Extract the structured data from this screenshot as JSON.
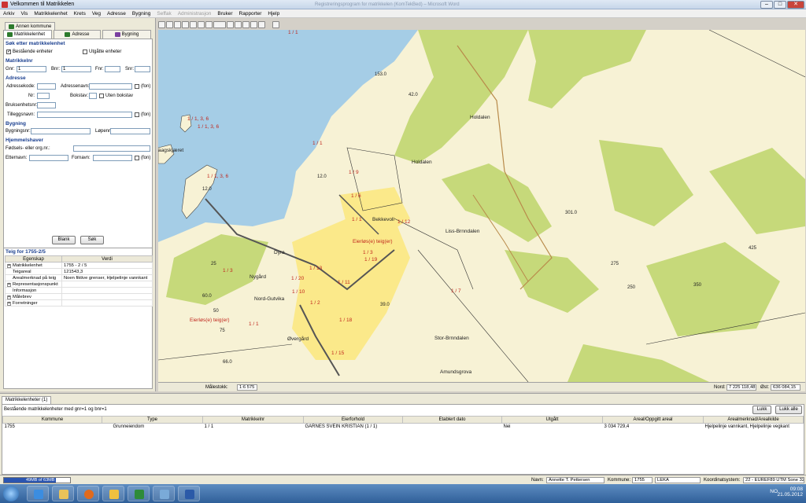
{
  "window": {
    "title": "Velkommen til Matrikkelen",
    "subtitle": "Registreringsprogram for matrikkelen (KomTekBed) – Microsoft Word"
  },
  "menu": [
    "Arkiv",
    "Vis",
    "Matrikkelenhet",
    "Krets",
    "Veg",
    "Adresse",
    "Bygning",
    "Seffak",
    "Administrasjon",
    "Bruker",
    "Rapporter",
    "Hjelp"
  ],
  "menu_disabled": [
    "Seffak",
    "Administrasjon"
  ],
  "search_tabs": {
    "annen_kommune": "Annen kommune",
    "matrikkelenhet": "Matrikkelenhet",
    "adresse": "Adresse",
    "bygning": "Bygning"
  },
  "form": {
    "heading": "Søk etter matrikkelenhet",
    "bestaende_label": "Bestående enheter",
    "utgatte_label": "Utgåtte enheter",
    "matrikkelnr_heading": "Matrikkelnr",
    "gnr_label": "Gnr:",
    "gnr_value": "1",
    "bnr_label": "Bnr:",
    "bnr_value": "1",
    "fnr_label": "Fnr:",
    "snr_label": "Snr:",
    "adresse_heading": "Adresse",
    "adressekode_label": "Adressekode:",
    "adressenavn_label": "Adressenavn:",
    "fon_label": "(fon)",
    "nr_label": "Nr:",
    "bokstav_label": "Bokstav:",
    "uten_bokstav_label": "Uten bokstav",
    "bruksenhetsnr_label": "Bruksenhetsnr:",
    "tilleggsnavn_label": "Tilleggsnavn:",
    "bygning_heading": "Bygning",
    "bygningsnr_label": "Bygningsnr:",
    "lopenr_label": "Løpenr:",
    "hjemmelshaver_heading": "Hjemmelshaver",
    "fodsels_label": "Fødsels- eller org.nr.:",
    "etternavn_label": "Etternavn:",
    "fornavn_label": "Fornavn:",
    "blank_button": "Blank",
    "sok_button": "Søk"
  },
  "teig": {
    "title": "Teig for 1755-2/5",
    "col_egenskap": "Egenskap",
    "col_verdi": "Verdi",
    "rows": [
      {
        "exp": "+",
        "key": "Matrikkelenhet",
        "val": "1755 - 2 / 5"
      },
      {
        "exp": "",
        "key": "Teigareal",
        "val": "121543,3"
      },
      {
        "exp": "",
        "key": "Arealmerknad på teig",
        "val": "Noen fiktive grenser, Hjelpelinje vannkant"
      },
      {
        "exp": "+",
        "key": "Representasjonspunkt",
        "val": ""
      },
      {
        "exp": "",
        "key": "Informasjon",
        "val": ""
      },
      {
        "exp": "+",
        "key": "Målebrev",
        "val": ""
      },
      {
        "exp": "+",
        "key": "Forretninger",
        "val": ""
      }
    ]
  },
  "map": {
    "scale_label": "Målestokk:",
    "scale_value": "1:6 575",
    "nord_label": "Nord:",
    "nord_value": "7 225 118,48",
    "ost_label": "Øst:",
    "ost_value": "636 084,15",
    "place_names": [
      "Holdalen",
      "Holdalen",
      "Lian",
      "Bekkevoll",
      "Liss-Brnndalen",
      "Dyra",
      "Nygård",
      "Nord-Gutvika",
      "Øvergård",
      "Stor-Brnndalen",
      "Amundsgrova",
      "aagskjæret"
    ],
    "heights": [
      "153.0",
      "42.0",
      "12.0",
      "12.0",
      "301.0",
      "275",
      "250",
      "39.0",
      "66.0",
      "60.0",
      "25",
      "50",
      "75",
      "425",
      "350"
    ],
    "parcel_labels": [
      "1 / 1",
      "1 / 1, 3, 6",
      "1 / 1, 3, 6",
      "1 / 1",
      "1 / 1, 3, 6",
      "1 / 9",
      "1 / 6",
      "1 / 1",
      "1 / 12",
      "1 / 3",
      "1 / 13",
      "1 / 19",
      "1 / 3",
      "1 / 20",
      "1 / 10",
      "1 / 11",
      "1 / 2",
      "1 / 7",
      "1 / 1",
      "1 / 18",
      "1 / 15"
    ],
    "eierlos_1": "Eierløs(e) teig(er)",
    "eierlos_2": "Eierløs(e) teig(er)"
  },
  "results": {
    "tab_label": "Matrikkelenheter (1)",
    "query_text": "Bestående matrikkelenheter med gnr=1 og bnr=1",
    "lukk_button": "Lukk",
    "lukk_alle_button": "Lukk alle",
    "columns": [
      "Kommune",
      "Type",
      "Matrikkelnr",
      "Eierforhold",
      "Etablert dato",
      "Utgått",
      "Areal/Oppgitt areal",
      "Arealmerknad/Arealkilde"
    ],
    "rows": [
      [
        "1755",
        "Grunneiendom",
        "1 / 1",
        "GARNES SVEIN KRISTIAN (1 / 1)",
        "",
        "Nei",
        "3 034 729,4",
        "Hjelpelinje vannkant, Hjelpelinje vegkant"
      ]
    ]
  },
  "status": {
    "memory": "49MB of 63MB",
    "memory_fraction": 0.78,
    "navn_label": "Navn:",
    "navn_value": "Annette T. Pettersen",
    "kommune_label": "Kommune:",
    "kommune_nr": "1755",
    "kommune_navn": "LEKA",
    "koord_label": "Koordinatsystem:",
    "koord_value": "22 - EUREF89 UTM Sone 32"
  },
  "taskbar": {
    "lang": "NO",
    "time": "09:08",
    "date": "21.05.2012"
  }
}
